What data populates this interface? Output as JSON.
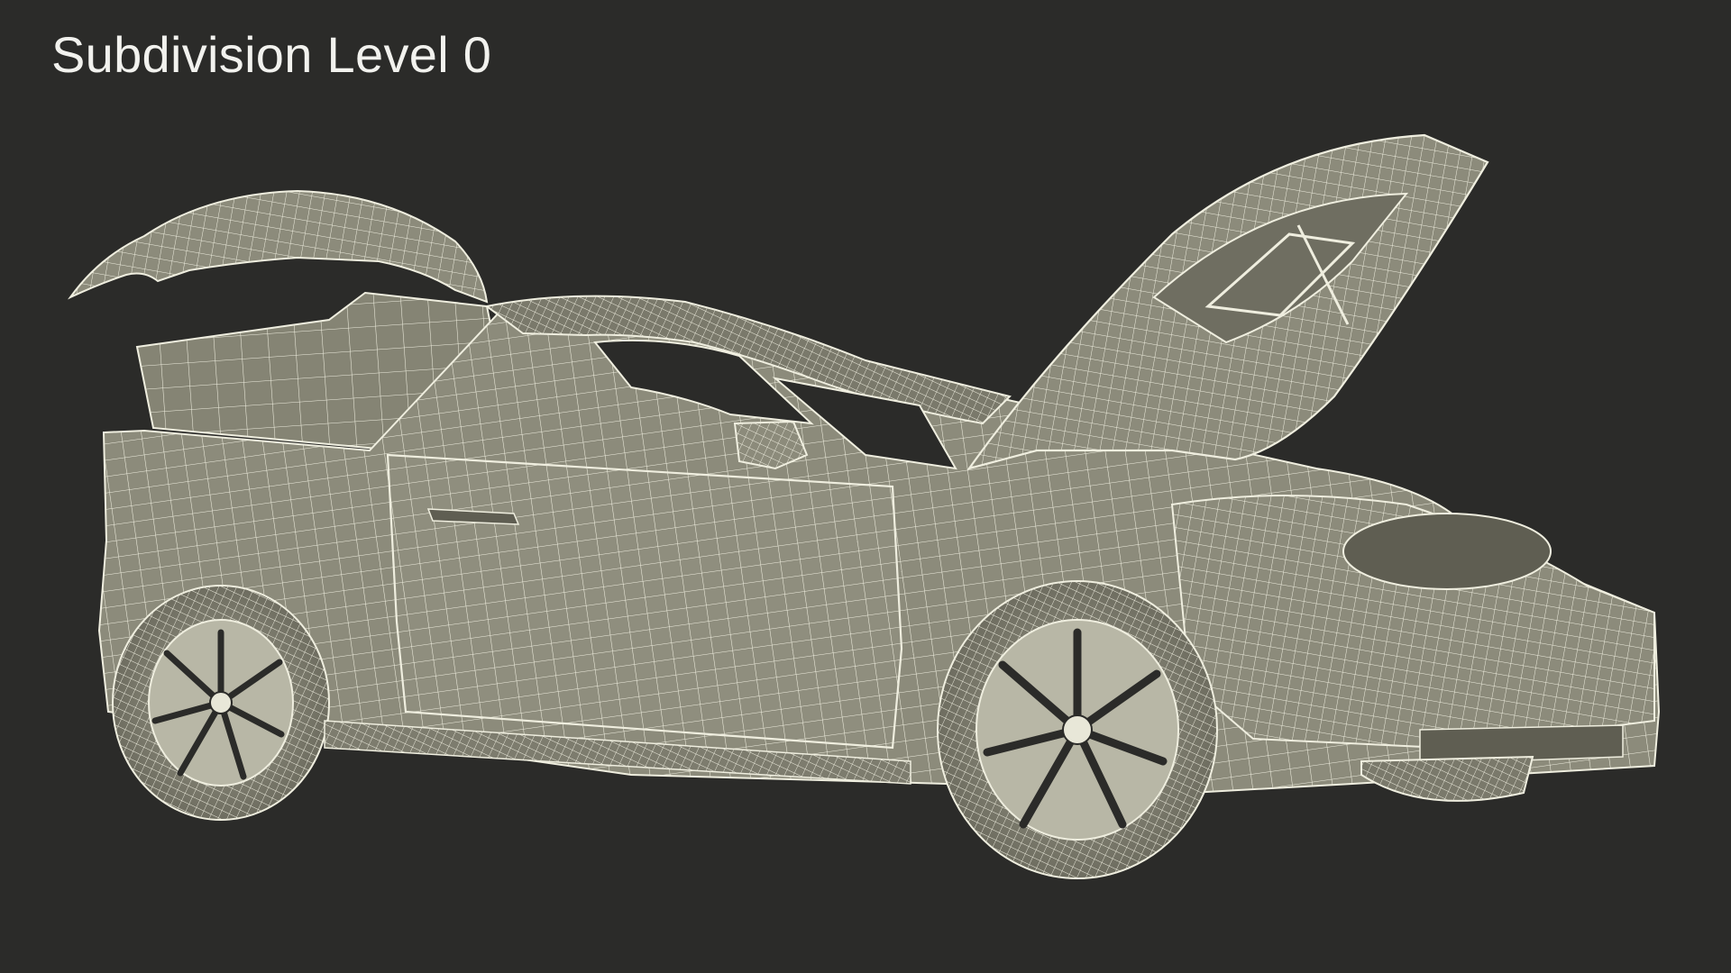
{
  "caption": "Subdivision Level 0",
  "colors": {
    "background": "#2b2b29",
    "surface": "#8c8b7b",
    "surface_dark": "#5f5e52",
    "wire": "#efeedf",
    "caption": "#f2f2ee"
  },
  "subject": "car-wireframe-render"
}
